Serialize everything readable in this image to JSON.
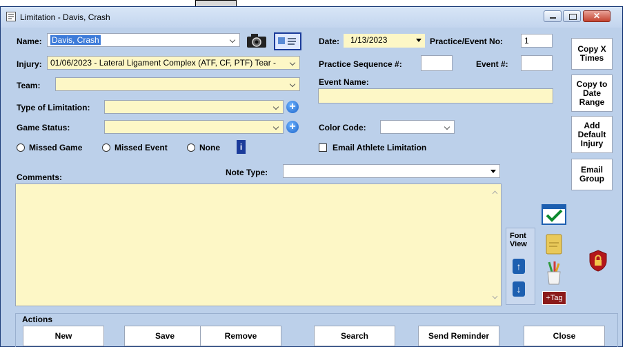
{
  "window": {
    "title": "Limitation - Davis, Crash"
  },
  "form": {
    "name_label": "Name:",
    "name_value": "Davis, Crash",
    "injury_label": "Injury:",
    "injury_value": "01/06/2023 - Lateral Ligament Complex (ATF, CF, PTF) Tear -",
    "team_label": "Team:",
    "type_label": "Type of Limitation:",
    "game_status_label": "Game Status:",
    "radio_missed_game": "Missed Game",
    "radio_missed_event": "Missed Event",
    "radio_none": "None",
    "date_label": "Date:",
    "date_value": "1/13/2023",
    "practice_event_label": "Practice/Event No:",
    "practice_event_value": "1",
    "practice_seq_label": "Practice Sequence #:",
    "event_num_label": "Event #:",
    "event_name_label": "Event Name:",
    "color_code_label": "Color Code:",
    "email_athlete_label": "Email Athlete Limitation",
    "comments_label": "Comments:",
    "note_type_label": "Note Type:"
  },
  "side_buttons": {
    "copy_x": "Copy X Times",
    "copy_date": "Copy to Date Range",
    "add_default": "Add Default Injury",
    "email_group": "Email Group"
  },
  "font_view": {
    "label": "Font View"
  },
  "tag_button": "+Tag",
  "actions": {
    "label": "Actions",
    "new": "New",
    "save": "Save",
    "remove": "Remove",
    "search": "Search",
    "send_reminder": "Send Reminder",
    "close": "Close"
  },
  "colors": {
    "window_bg": "#bcd0ea",
    "field_yellow": "#fdf7c6",
    "accent_blue": "#1d5fb0"
  }
}
